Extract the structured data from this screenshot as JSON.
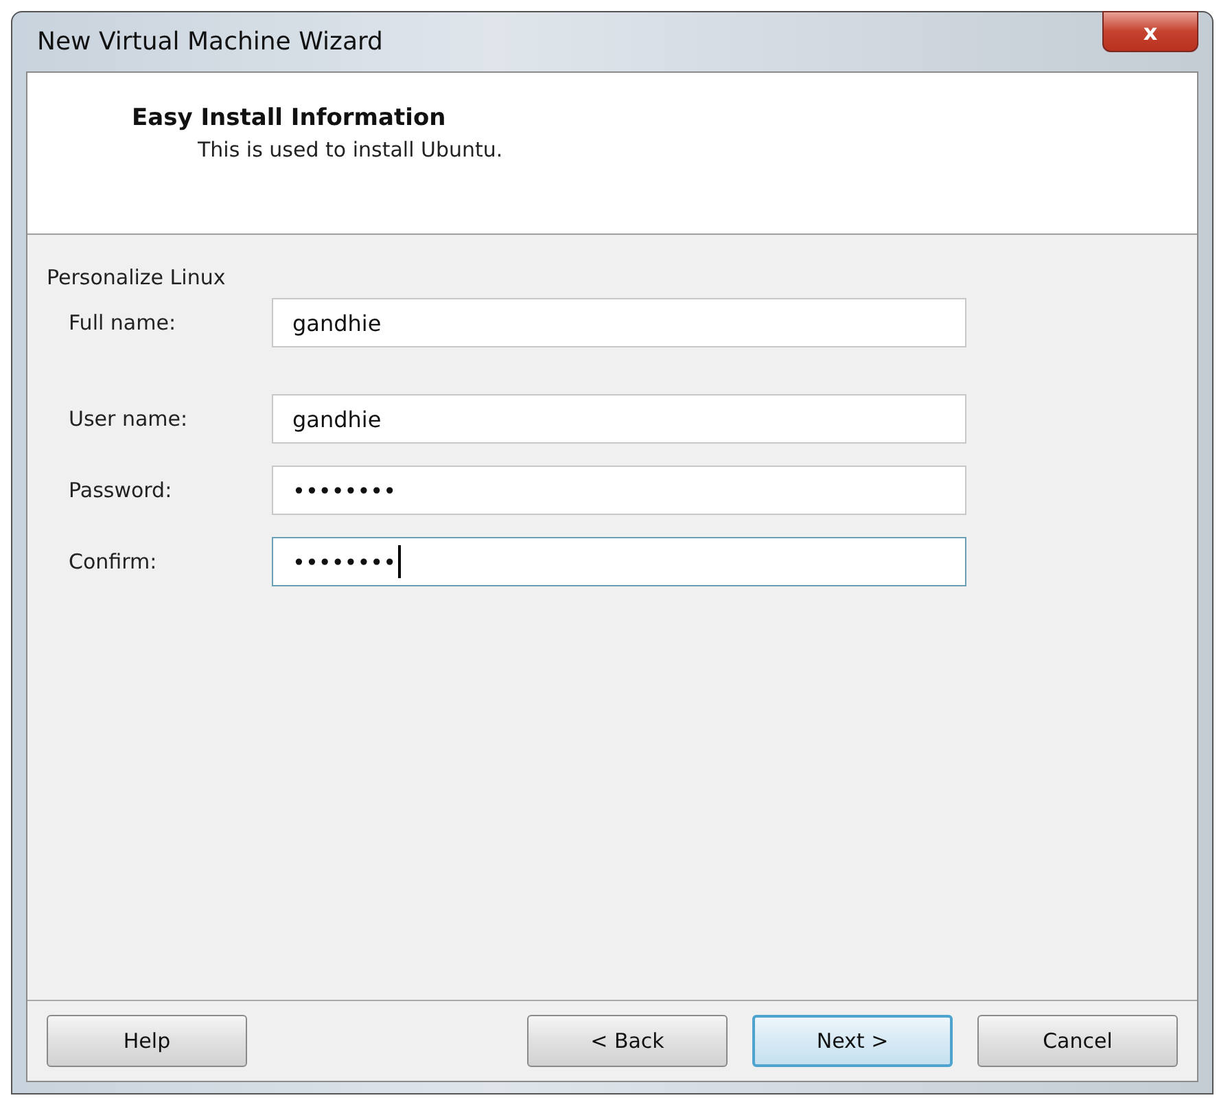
{
  "window": {
    "title": "New Virtual Machine Wizard",
    "close_label": "x"
  },
  "header": {
    "title": "Easy Install Information",
    "subtitle": "This is used to install Ubuntu."
  },
  "group": {
    "label": "Personalize Linux"
  },
  "fields": [
    {
      "label": "Full name:",
      "value": "gandhie",
      "focused": false
    },
    {
      "label": "User name:",
      "value": "gandhie",
      "focused": false
    },
    {
      "label": "Password:",
      "value": "••••••••",
      "focused": false
    },
    {
      "label": "Confirm:",
      "value": "••••••••",
      "focused": true
    }
  ],
  "left_buttons": [
    {
      "label": "Help",
      "default": false
    }
  ],
  "buttons": [
    {
      "label": "< Back",
      "default": false
    },
    {
      "label": "Next >",
      "default": true
    },
    {
      "label": "Cancel",
      "default": false
    }
  ]
}
